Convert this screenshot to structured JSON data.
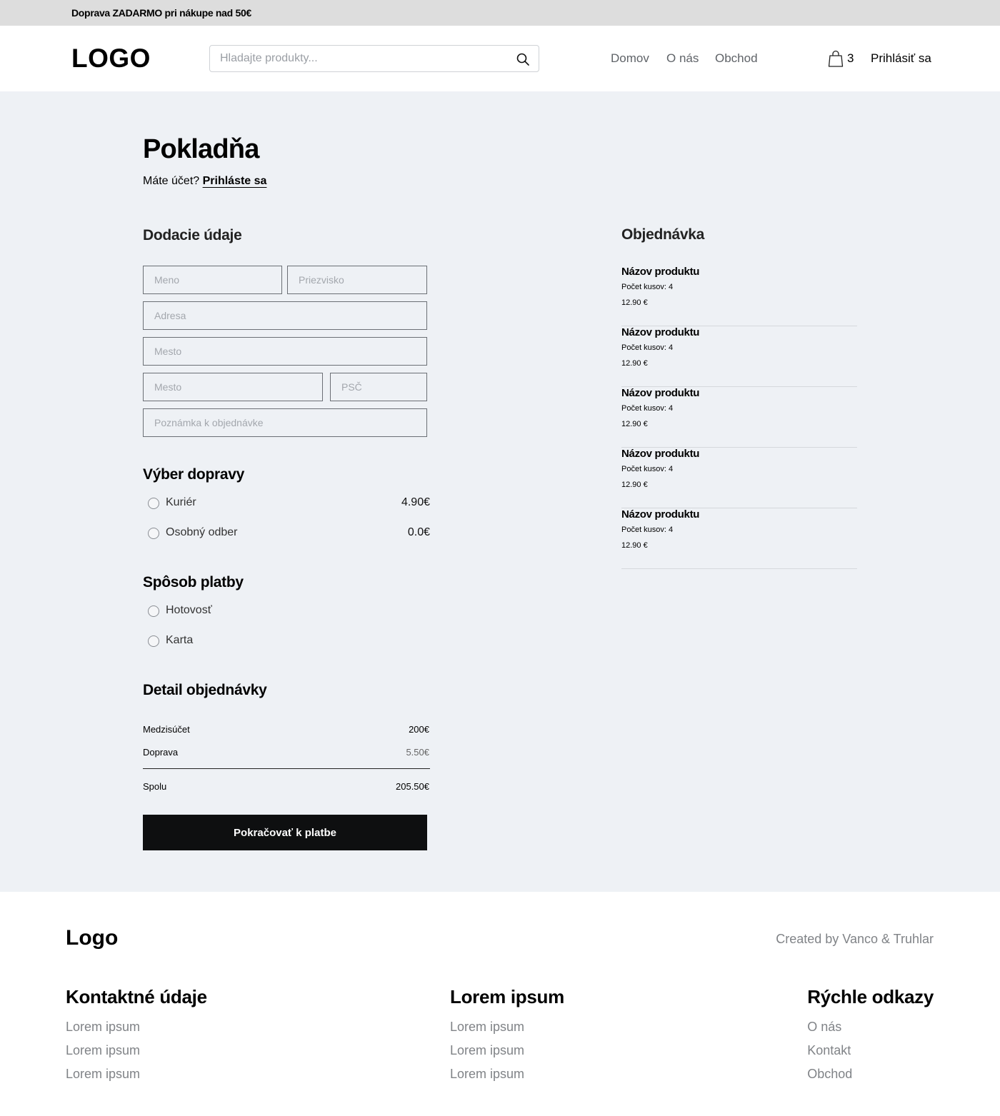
{
  "promo": {
    "text": "Doprava ZADARMO pri  nákupe nad 50€"
  },
  "header": {
    "logo": "LOGO",
    "search_placeholder": "Hladajte produkty...",
    "nav": [
      "Domov",
      "O nás",
      "Obchod"
    ],
    "cart_count": "3",
    "login": "Prihlásiť sa"
  },
  "checkout": {
    "title": "Pokladňa",
    "account_question": "Máte účet?",
    "account_link": "Prihláste sa",
    "delivery_title": "Dodacie údaje",
    "fields": {
      "first_name": "Meno",
      "last_name": "Priezvisko",
      "address": "Adresa",
      "city1": "Mesto",
      "city2": "Mesto",
      "zip": "PSČ",
      "note": "Poznámka k objednávke"
    },
    "shipping_title": "Výber dopravy",
    "shipping": [
      {
        "label": "Kuriér",
        "price": "4.90€"
      },
      {
        "label": "Osobný odber",
        "price": "0.0€"
      }
    ],
    "payment_title": "Spôsob platby",
    "payment": [
      {
        "label": "Hotovosť"
      },
      {
        "label": "Karta"
      }
    ],
    "detail_title": "Detail objednávky",
    "summary": {
      "subtotal_label": "Medzisúčet",
      "subtotal_value": "200€",
      "shipping_label": "Doprava",
      "shipping_value": "5.50€",
      "total_label": "Spolu",
      "total_value": "205.50€"
    },
    "cta": "Pokračovať k platbe"
  },
  "order": {
    "title": "Objednávka",
    "items": [
      {
        "name": "Názov produktu",
        "qty": "Počet kusov: 4",
        "price": "12.90 €"
      },
      {
        "name": "Názov produktu",
        "qty": "Počet kusov: 4",
        "price": "12.90 €"
      },
      {
        "name": "Názov produktu",
        "qty": "Počet kusov: 4",
        "price": "12.90 €"
      },
      {
        "name": "Názov produktu",
        "qty": "Počet kusov: 4",
        "price": "12.90 €"
      },
      {
        "name": "Názov produktu",
        "qty": "Počet kusov: 4",
        "price": "12.90 €"
      }
    ]
  },
  "footer": {
    "logo": "Logo",
    "credit": "Created by Vanco & Truhlar",
    "columns": [
      {
        "title": "Kontaktné údaje",
        "links": [
          "Lorem ipsum",
          "Lorem ipsum",
          "Lorem ipsum"
        ]
      },
      {
        "title": "Lorem ipsum",
        "links": [
          "Lorem ipsum",
          "Lorem ipsum",
          "Lorem ipsum"
        ]
      },
      {
        "title": "Rýchle odkazy",
        "links": [
          "O nás",
          "Kontakt",
          "Obchod"
        ]
      }
    ]
  },
  "icons": {
    "search": "search-icon",
    "cart": "shopping-bag-icon"
  }
}
